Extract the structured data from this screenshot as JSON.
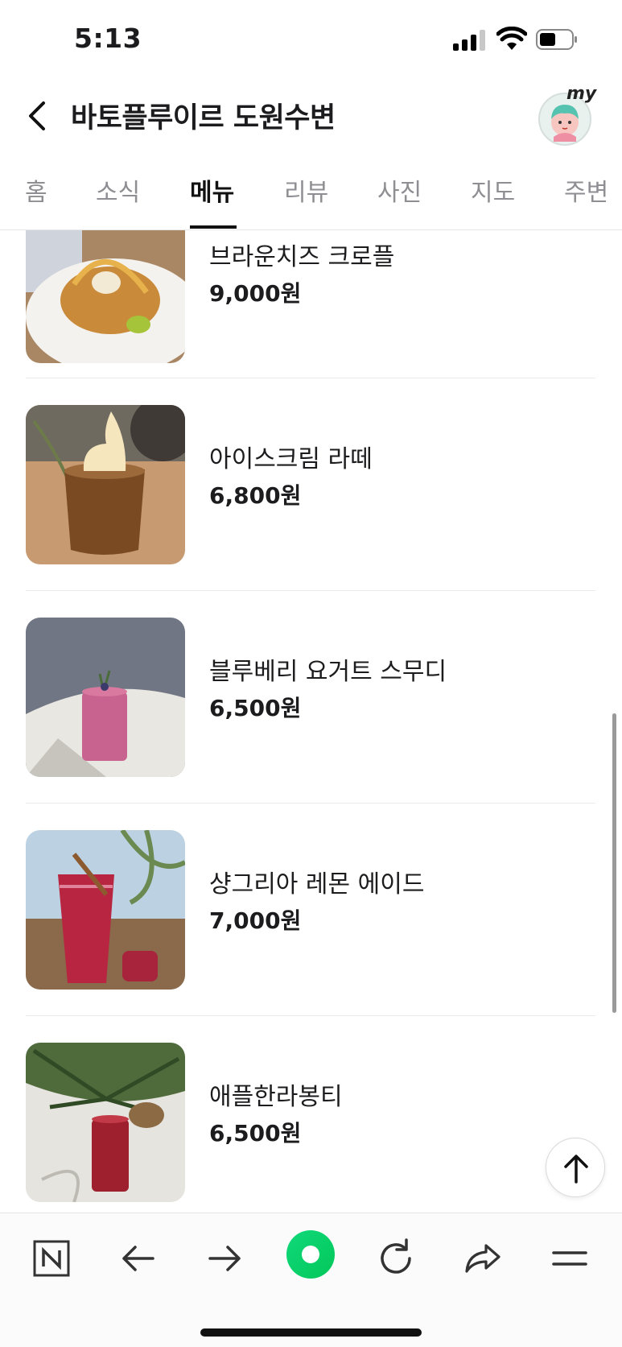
{
  "status_bar": {
    "time": "5:13"
  },
  "header": {
    "title": "바토플루이르 도원수변",
    "avatar_badge": "my"
  },
  "tabs": [
    {
      "label": "홈",
      "active": false
    },
    {
      "label": "소식",
      "active": false
    },
    {
      "label": "메뉴",
      "active": true
    },
    {
      "label": "리뷰",
      "active": false
    },
    {
      "label": "사진",
      "active": false
    },
    {
      "label": "지도",
      "active": false
    },
    {
      "label": "주변",
      "active": false
    }
  ],
  "menu": {
    "items": [
      {
        "name": "브라운치즈 크로플",
        "price": "9,000원",
        "image": "brown-cheese-croffle-photo"
      },
      {
        "name": "아이스크림 라떼",
        "price": "6,800원",
        "image": "ice-cream-latte-photo"
      },
      {
        "name": "블루베리 요거트 스무디",
        "price": "6,500원",
        "image": "blueberry-yogurt-smoothie-photo"
      },
      {
        "name": "샹그리아 레몬 에이드",
        "price": "7,000원",
        "image": "sangria-lemonade-photo"
      },
      {
        "name": "애플한라봉티",
        "price": "6,500원",
        "image": "apple-hallabong-tea-photo"
      }
    ]
  },
  "toolbar": {
    "buttons": [
      "naver-logo-icon",
      "arrow-left-icon",
      "arrow-right-icon",
      "green-dot-home-icon",
      "reload-icon",
      "share-icon",
      "menu-icon"
    ]
  },
  "colors": {
    "accent_green": "#03c75a",
    "text_primary": "#1c1c1e",
    "text_inactive": "#8e8e93"
  }
}
